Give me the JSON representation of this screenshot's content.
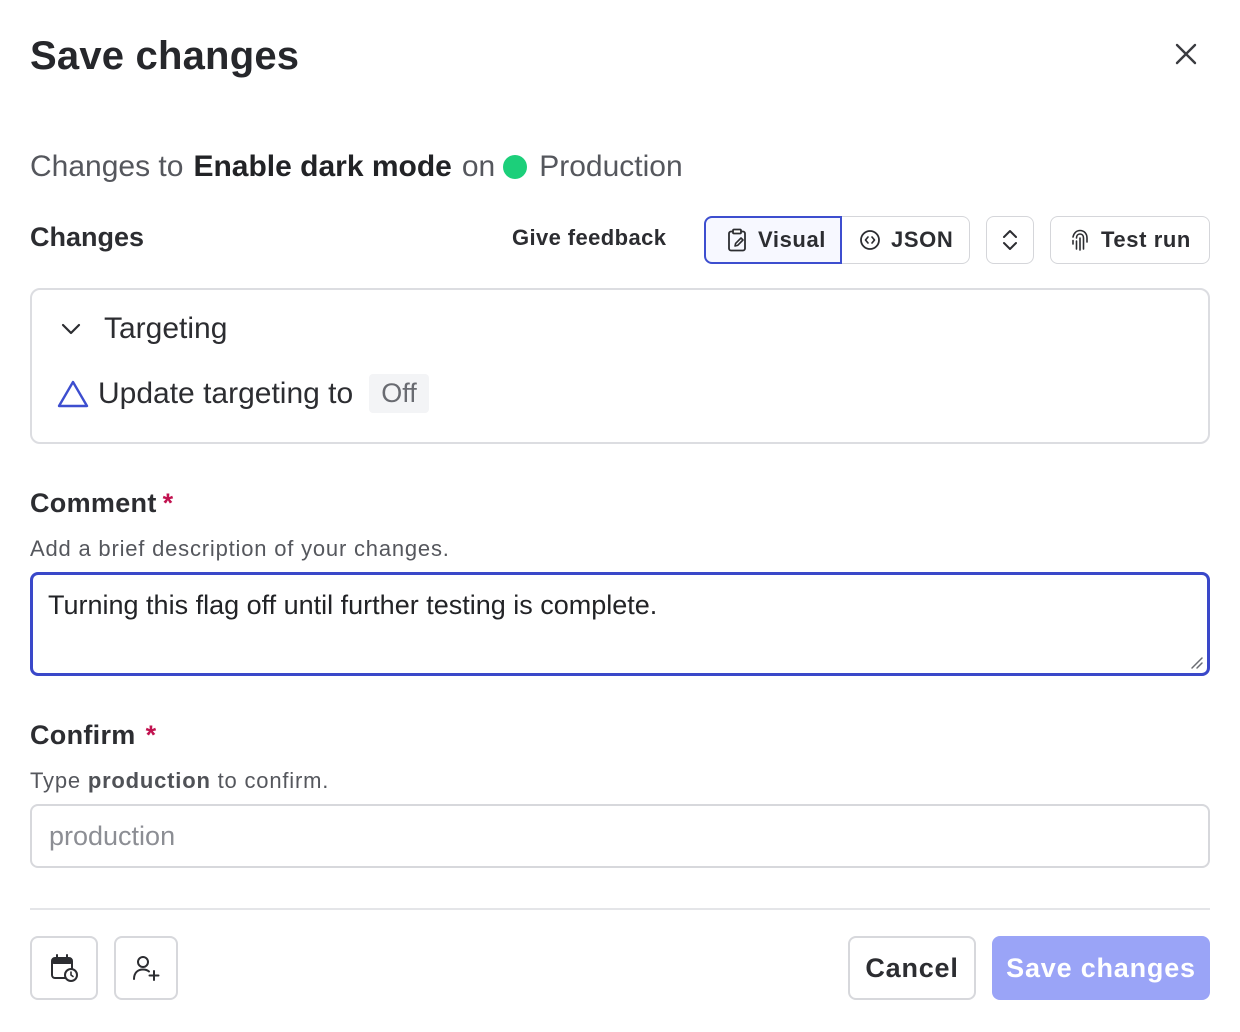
{
  "dialog": {
    "title": "Save changes",
    "close_icon": "close-icon"
  },
  "subtitle": {
    "prefix": "Changes to",
    "flag_name": "Enable dark mode",
    "on": "on",
    "environment": "Production",
    "environment_color": "#1ccf7a"
  },
  "toolbar": {
    "changes_label": "Changes",
    "give_feedback": "Give feedback",
    "visual_label": "Visual",
    "json_label": "JSON",
    "test_run_label": "Test run",
    "active_view": "Visual"
  },
  "targeting": {
    "section_label": "Targeting",
    "instruction_text": "Update targeting to",
    "value": "Off"
  },
  "comment": {
    "label": "Comment",
    "required_mark": "*",
    "help": "Add a brief description of your changes.",
    "value": "Turning this flag off until further testing is complete."
  },
  "confirm": {
    "label": "Confirm",
    "required_mark": "*",
    "help_prefix": "Type",
    "help_keyword": "production",
    "help_suffix": "to confirm.",
    "placeholder": "production"
  },
  "footer": {
    "cancel_label": "Cancel",
    "save_label": "Save changes"
  },
  "colors": {
    "accent": "#3d4ecf",
    "save_button_disabled": "#9aa4f7",
    "required": "#c1124f"
  }
}
